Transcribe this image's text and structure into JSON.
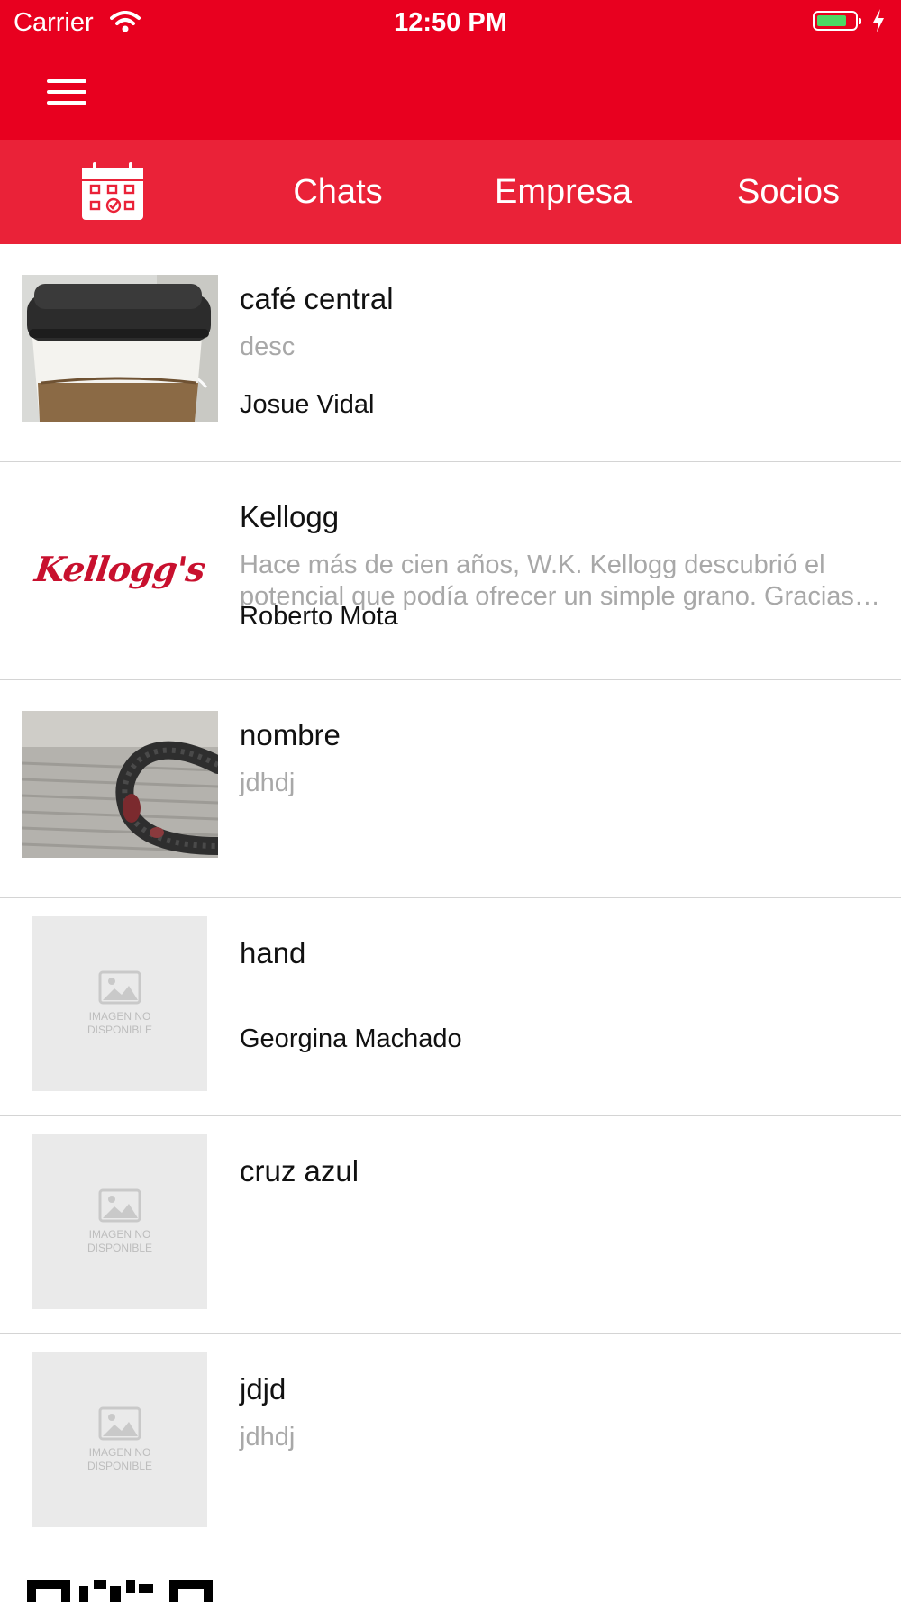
{
  "status_bar": {
    "carrier": "Carrier",
    "time": "12:50 PM"
  },
  "tabs": [
    {
      "id": "calendar",
      "icon": "calendar-check-icon"
    },
    {
      "id": "chats",
      "label": "Chats"
    },
    {
      "id": "empresa",
      "label": "Empresa"
    },
    {
      "id": "socios",
      "label": "Socios"
    }
  ],
  "placeholder": {
    "line1": "IMAGEN NO",
    "line2": "DISPONIBLE"
  },
  "items": [
    {
      "title": "café central",
      "description": "desc",
      "owner": "Josue Vidal",
      "image": "coffee-cup-photo"
    },
    {
      "title": "Kellogg",
      "description": "Hace más de cien años, W.K. Kellogg descubrió el potencial que podía ofrecer un simple grano. Gracias a su innovación y visión",
      "owner": "Roberto Mota",
      "image": "kelloggs-logo",
      "logo_text": "Kellogg's"
    },
    {
      "title": "nombre",
      "description": "jdhdj",
      "owner": "",
      "image": "snake-on-concrete-photo"
    },
    {
      "title": "hand",
      "description": "",
      "owner": "Georgina Machado",
      "image": "image-unavailable-placeholder"
    },
    {
      "title": "cruz azul",
      "description": "",
      "owner": "",
      "image": "image-unavailable-placeholder"
    },
    {
      "title": "jdjd",
      "description": "jdhdj",
      "owner": "",
      "image": "image-unavailable-placeholder"
    }
  ],
  "colors": {
    "primary": "#e8001f",
    "tab_bar": "#ea2238",
    "divider": "#d4d4d4",
    "secondary_text": "#a8a8a8"
  }
}
